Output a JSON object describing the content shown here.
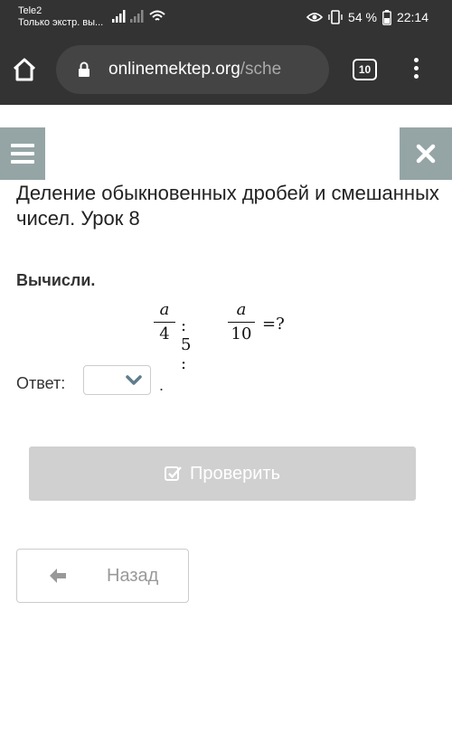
{
  "status_bar": {
    "carrier_line1": "Tele2",
    "carrier_line2": "Только экстр. вы...",
    "battery": "54 %",
    "time": "22:14"
  },
  "browser": {
    "url_host": "onlinemektep.org",
    "url_rest": "/sche",
    "tab_count": "10"
  },
  "page": {
    "title": "Деление обыкновенных дробей и смешанных чисел. Урок 8",
    "task_label": "Вычисли.",
    "formula": {
      "frac1_num": "a",
      "frac1_den": "4",
      "op1": ": 5 :",
      "frac2_num": "a",
      "frac2_den": "10",
      "equals": "=?"
    },
    "answer_label": "Ответ:",
    "answer_period": ".",
    "check_button": "Проверить",
    "back_button": "Назад"
  },
  "colors": {
    "toolbar": "#333333",
    "side_buttons": "#95a5a6",
    "check_button_disabled": "#d0d0d0"
  }
}
